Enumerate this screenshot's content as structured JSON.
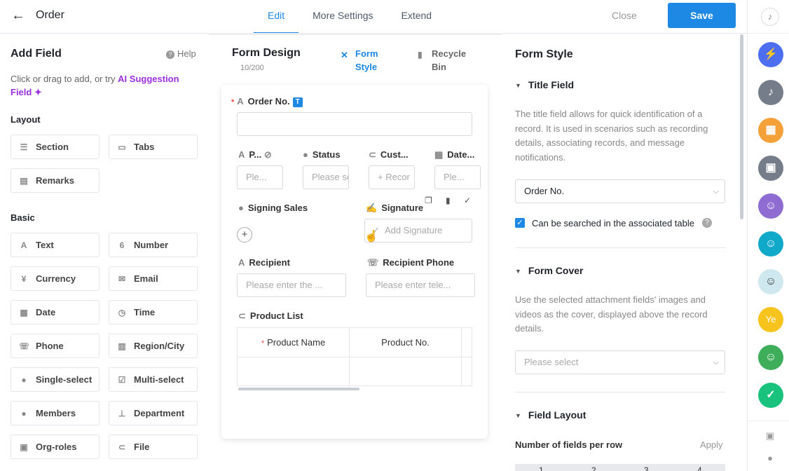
{
  "header": {
    "back_icon": "arrow-left-icon",
    "title": "Order",
    "tabs": [
      {
        "label": "Edit",
        "active": true
      },
      {
        "label": "More Settings",
        "active": false
      },
      {
        "label": "Extend",
        "active": false
      }
    ],
    "close_label": "Close",
    "save_label": "Save"
  },
  "left": {
    "title": "Add Field",
    "help_label": "Help",
    "hint_prefix": "Click or drag to add, or try ",
    "hint_link": "AI Suggestion Field",
    "hint_sparkle": "✦",
    "layout_label": "Layout",
    "layout_items": [
      {
        "label": "Section",
        "icon": "section-icon"
      },
      {
        "label": "Tabs",
        "icon": "tabs-icon"
      },
      {
        "label": "Remarks",
        "icon": "remarks-icon"
      }
    ],
    "basic_label": "Basic",
    "basic_items": [
      {
        "label": "Text",
        "icon": "text-icon"
      },
      {
        "label": "Number",
        "icon": "number-icon"
      },
      {
        "label": "Currency",
        "icon": "currency-icon"
      },
      {
        "label": "Email",
        "icon": "email-icon"
      },
      {
        "label": "Date",
        "icon": "calendar-icon"
      },
      {
        "label": "Time",
        "icon": "clock-icon"
      },
      {
        "label": "Phone",
        "icon": "phone-icon"
      },
      {
        "label": "Region/City",
        "icon": "map-icon"
      },
      {
        "label": "Single-select",
        "icon": "single-select-icon"
      },
      {
        "label": "Multi-select",
        "icon": "multi-select-icon"
      },
      {
        "label": "Members",
        "icon": "member-icon"
      },
      {
        "label": "Department",
        "icon": "department-icon"
      },
      {
        "label": "Org-roles",
        "icon": "org-role-icon"
      },
      {
        "label": "File",
        "icon": "attachment-icon"
      }
    ]
  },
  "center": {
    "title": "Form Design",
    "count": "10/200",
    "form_style_tab": "Form Style",
    "recycle_bin_tab": "Recycle Bin",
    "order_no_label": "Order No.",
    "order_no_badge": "T",
    "row_fields": [
      {
        "label": "P...",
        "placeholder": "Ple..."
      },
      {
        "label": "Status",
        "placeholder": "Please se"
      },
      {
        "label": "Cust...",
        "placeholder": "+ Recor"
      },
      {
        "label": "Date...",
        "placeholder": "Ple..."
      }
    ],
    "signing_sales_label": "Signing Sales",
    "signature_label": "Signature",
    "signature_placeholder": "Add Signature",
    "recipient_label": "Recipient",
    "recipient_placeholder": "Please enter the ...",
    "recipient_phone_label": "Recipient Phone",
    "recipient_phone_placeholder": "Please enter tele...",
    "product_list_label": "Product List",
    "table_headers": [
      "Product Name",
      "Product No."
    ]
  },
  "right": {
    "title": "Form Style",
    "title_field_heading": "Title Field",
    "title_field_desc": "The title field allows for quick identification of a record. It is used in scenarios such as recording details, associating records, and message notifications.",
    "title_field_value": "Order No.",
    "searchable_label": "Can be searched in the associated table",
    "form_cover_heading": "Form Cover",
    "form_cover_desc": "Use the selected attachment fields' images and videos as the cover, displayed above the record details.",
    "form_cover_placeholder": "Please select",
    "field_layout_heading": "Field Layout",
    "fields_per_row_label": "Number of fields per row",
    "apply_label": "Apply",
    "layout_options": [
      "1",
      "2",
      "3",
      "4"
    ]
  },
  "sidebar": {
    "avatar_text": "Ye",
    "colors": {
      "ai": "#4e6ef2",
      "bell": "#757d8a",
      "apps": "#f5a13a",
      "work": "#757d8a",
      "group1": "#8e6cd1",
      "group2": "#11a9c9",
      "ye": "#f7c31d",
      "group3": "#3fae5a",
      "check": "#19c37d"
    }
  },
  "colors": {
    "accent": "#1e88e5",
    "ai_purple": "#9b30e0",
    "required": "#f53f3f"
  }
}
